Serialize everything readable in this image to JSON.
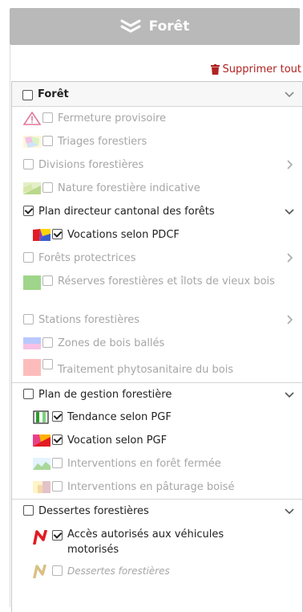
{
  "header": {
    "title": "Forêt"
  },
  "actions": {
    "delete_all": "Supprimer tout"
  },
  "colors": {
    "header_bg": "#b9b9b9",
    "delete_red": "#b22222",
    "text_dim": "#a6a6a6"
  },
  "tree": {
    "root_label": "Forêt",
    "items": [
      {
        "label": "Fermeture provisoire",
        "icon": "warning-triangle-icon"
      },
      {
        "label": "Triages forestiers",
        "icon": "pastel-patches-legend-icon"
      },
      {
        "label": "Divisions forestières"
      },
      {
        "label": "Nature forestière indicative",
        "icon": "green-gradient-legend-icon"
      },
      {
        "label": "Plan directeur cantonal des forêts"
      },
      {
        "label": "Vocations selon PDCF",
        "icon": "multicolor-vocation-legend-icon"
      },
      {
        "label": "Forêts protectrices"
      },
      {
        "label": "Réserves forestières et îlots de vieux bois",
        "icon": "green-square-legend-icon"
      },
      {
        "label": "Stations forestières"
      },
      {
        "label": "Zones de bois ballés",
        "icon": "blue-pink-legend-icon"
      },
      {
        "label": "Traitement phytosanitaire du bois",
        "icon": "pink-square-legend-icon"
      },
      {
        "label": "Plan de gestion forestière"
      },
      {
        "label": "Tendance selon PGF",
        "icon": "green-bars-legend-icon"
      },
      {
        "label": "Vocation selon PGF",
        "icon": "multicolor-pgf-legend-icon"
      },
      {
        "label": "Interventions en forêt fermée",
        "icon": "green-mountain-legend-icon"
      },
      {
        "label": "Interventions en pâturage boisé",
        "icon": "pasture-legend-icon"
      },
      {
        "label": "Dessertes forestières"
      },
      {
        "label": "Accès autorisés aux véhicules motorisés",
        "icon": "red-n-legend-icon"
      },
      {
        "label": "Dessertes forestières",
        "icon": "tan-n-legend-icon"
      }
    ]
  }
}
